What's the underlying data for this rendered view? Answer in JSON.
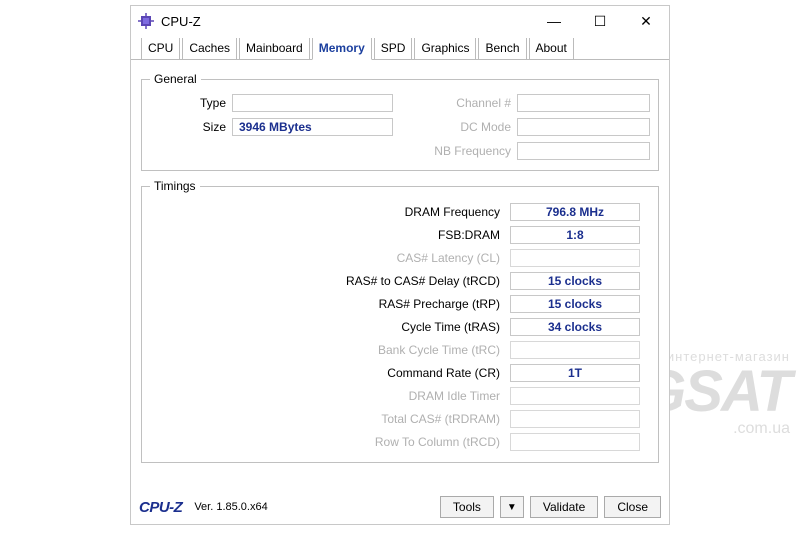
{
  "title": "CPU-Z",
  "tabs": [
    "CPU",
    "Caches",
    "Mainboard",
    "Memory",
    "SPD",
    "Graphics",
    "Bench",
    "About"
  ],
  "active_tab": 3,
  "general": {
    "legend": "General",
    "left": [
      {
        "label": "Type",
        "value": "",
        "disabled": false
      },
      {
        "label": "Size",
        "value": "3946 MBytes",
        "disabled": false
      }
    ],
    "right": [
      {
        "label": "Channel #",
        "value": "",
        "disabled": true
      },
      {
        "label": "DC Mode",
        "value": "",
        "disabled": true
      },
      {
        "label": "NB Frequency",
        "value": "",
        "disabled": true
      }
    ]
  },
  "timings": {
    "legend": "Timings",
    "rows": [
      {
        "label": "DRAM Frequency",
        "value": "796.8 MHz",
        "disabled": false
      },
      {
        "label": "FSB:DRAM",
        "value": "1:8",
        "disabled": false
      },
      {
        "label": "CAS# Latency (CL)",
        "value": "",
        "disabled": true
      },
      {
        "label": "RAS# to CAS# Delay (tRCD)",
        "value": "15 clocks",
        "disabled": false
      },
      {
        "label": "RAS# Precharge (tRP)",
        "value": "15 clocks",
        "disabled": false
      },
      {
        "label": "Cycle Time (tRAS)",
        "value": "34 clocks",
        "disabled": false
      },
      {
        "label": "Bank Cycle Time (tRC)",
        "value": "",
        "disabled": true
      },
      {
        "label": "Command Rate (CR)",
        "value": "1T",
        "disabled": false
      },
      {
        "label": "DRAM Idle Timer",
        "value": "",
        "disabled": true
      },
      {
        "label": "Total CAS# (tRDRAM)",
        "value": "",
        "disabled": true
      },
      {
        "label": "Row To Column (tRCD)",
        "value": "",
        "disabled": true
      }
    ]
  },
  "footer": {
    "brand": "CPU-Z",
    "version": "Ver. 1.85.0.x64",
    "tools": "Tools",
    "validate": "Validate",
    "close": "Close"
  },
  "watermark": {
    "line1": "интернет-магазин",
    "line2": "AGSAT",
    "line3": ".com.ua"
  }
}
